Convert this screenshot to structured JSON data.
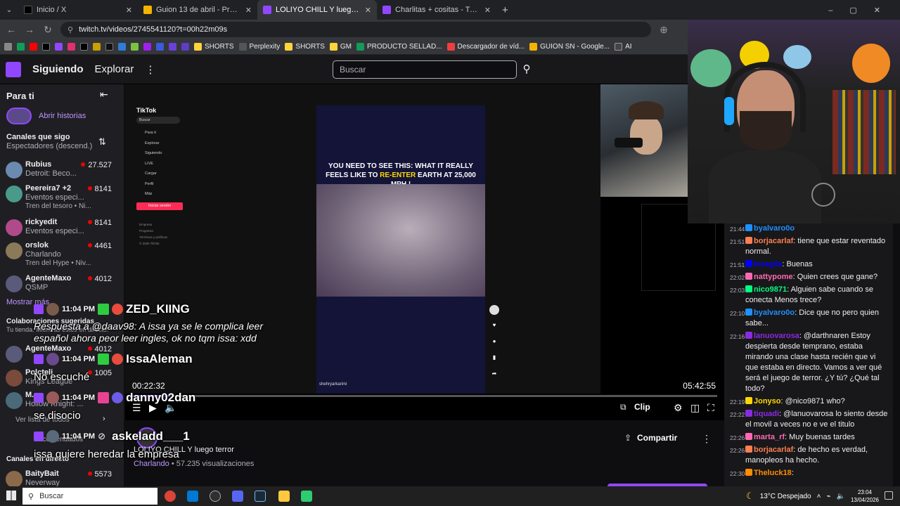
{
  "browser": {
    "tabs": [
      {
        "title": "Inicio / X",
        "color": "#000000"
      },
      {
        "title": "Guion 13 de abril - Presentacio",
        "color": "#f4b400"
      },
      {
        "title": "LOLIYO CHILL Y luego terror - T",
        "color": "#9147ff"
      },
      {
        "title": "Charlitas + cositas - Twitch",
        "color": "#9147ff"
      }
    ],
    "url": "twitch.tv/videos/2745541120?t=00h22m09s",
    "bookmarks": [
      "SHORTS",
      "Perplexity",
      "SHORTS",
      "GM",
      "PRODUCTO SELLAD...",
      "Descargador de víd...",
      "GUION SN - Google...",
      "AI"
    ]
  },
  "twitch": {
    "nav": {
      "following": "Siguiendo",
      "browse": "Explorar"
    },
    "search_placeholder": "Buscar"
  },
  "sidebar": {
    "title": "Para ti",
    "stories": "Abrir historias",
    "followed_title": "Canales que sigo",
    "followed_sort": "Espectadores (descend.)",
    "channels": [
      {
        "name": "Rubius",
        "category": "Detroit: Beco...",
        "viewers": "27.527",
        "color": "#6a8ab0"
      },
      {
        "name": "Peereira7 +2",
        "category": "Eventos especi...",
        "sub": "Tren del tesoro • Ni...",
        "viewers": "8141",
        "color": "#4a9a8a"
      },
      {
        "name": "rickyedit",
        "category": "Eventos especi...",
        "viewers": "8141",
        "color": "#b04a8a"
      },
      {
        "name": "orslok",
        "category": "Charlando",
        "sub": "Tren del Hype • Niv...",
        "viewers": "4461",
        "color": "#8a7a5a"
      },
      {
        "name": "AgenteMaxo",
        "category": "QSMP",
        "viewers": "4012",
        "color": "#5a5a7a"
      }
    ],
    "show_more": "Mostrar más",
    "collab_title": "Colaboraciones sugeridas",
    "collab_sub": "Tu tienda. Mientras estés en directo.",
    "collab": [
      {
        "name": "AgenteMaxo",
        "viewers": "4012"
      },
      {
        "name": "Polcteli",
        "category": "Kings League",
        "viewers": "1005"
      },
      {
        "name": "M...",
        "category": "Hollow Knight: ..."
      }
    ],
    "show_all": "Ver lista de todos",
    "recommended": "Recomendados",
    "live_title": "Canales en directo",
    "live": [
      {
        "name": "BaityBait",
        "category": "Neverway",
        "viewers": "5573"
      }
    ]
  },
  "player": {
    "tiktok": {
      "logo": "TikTok",
      "search": "Buscar",
      "menu": [
        "Para ti",
        "Explorar",
        "Siguiendo",
        "LIVE",
        "Cargar",
        "Perfil",
        "Más"
      ],
      "login": "Iniciar sesión",
      "footer": [
        "Empresa",
        "Programa",
        "Términos y políticas",
        "© 2026 TikTok"
      ],
      "video_text_1": "YOU NEED TO SEE THIS: WHAT IT REALLY FEELS LIKE TO ",
      "video_text_hl": "RE-ENTER",
      "video_text_2": " EARTH AT 25,000 MPH !",
      "author": "shehryarkarimi"
    },
    "time_current": "00:22:32",
    "time_total": "05:42:55",
    "progress": 0.066,
    "clip": "Clip"
  },
  "overlay_chat": [
    {
      "time": "11:04 PM",
      "user": "ZED_KIING",
      "text": "Respuesta a @daav98: A issa ya se le complica leer español ahora peor leer ingles, ok no tqm issa: xdd"
    },
    {
      "time": "11:04 PM",
      "user": "IssaAleman",
      "text": "No escuché"
    },
    {
      "time": "11:04 PM",
      "user": "danny02dan",
      "text": "se disocio"
    },
    {
      "time": "11:04 PM",
      "user": "askeladd___1",
      "text": "issa quiere heredar la empresa"
    }
  ],
  "video_info": {
    "title": "LOLIYO CHILL Y luego terror",
    "category": "Charlando",
    "views": "• 57.235 visualizaciones",
    "share": "Compartir"
  },
  "chat": [
    {
      "time": "21:44",
      "user": "byalvaro0o",
      "color": "#1e90ff",
      "text": ""
    },
    {
      "time": "21:51",
      "user": "borjacarlaf",
      "color": "#ff7f50",
      "text": ": tiene que estar reventado normal."
    },
    {
      "time": "21:51",
      "user": "luzagila",
      "color": "#0000ff",
      "text": ": Buenas"
    },
    {
      "time": "22:02",
      "user": "nattypome",
      "color": "#ff69b4",
      "text": ": Quien crees que gane?"
    },
    {
      "time": "22:03",
      "user": "nico9871",
      "color": "#00ff7f",
      "text": ": Alguien sabe cuando se conecta Menos trece?"
    },
    {
      "time": "22:10",
      "user": "byalvaro0o",
      "color": "#1e90ff",
      "text": ": Dice que no pero quien sabe..."
    },
    {
      "time": "22:16",
      "user": "lanuovarosa",
      "color": "#8a2be2",
      "text": ": @darthnaren Estoy despierta desde temprano, estaba mirando una clase hasta recién que vi que estaba en directo. Vamos a ver qué será el juego de terror. ¿Y tú? ¿Qué tal todo?"
    },
    {
      "time": "22:19",
      "user": "Jonyso",
      "color": "#ffd700",
      "text": ": @nico9871 who?"
    },
    {
      "time": "22:22",
      "user": "tiquadi",
      "color": "#8a2be2",
      "text": ": @lanuovarosa lo siento desde el movil a veces no e ve el titulo"
    },
    {
      "time": "22:26",
      "user": "marta_rf",
      "color": "#ff69b4",
      "text": ": Muy buenas tardes"
    },
    {
      "time": "22:26",
      "user": "borjacarlaf",
      "color": "#ff7f50",
      "text": ": de hecho es verdad, manopleos ha hecho."
    },
    {
      "time": "22:30",
      "user": "Theluck18",
      "color": "#ff8c00",
      "text": ":"
    }
  ],
  "taskbar": {
    "search": "Buscar",
    "weather": "13°C  Despejado",
    "time": "23:04",
    "date": "13/04/2026"
  }
}
